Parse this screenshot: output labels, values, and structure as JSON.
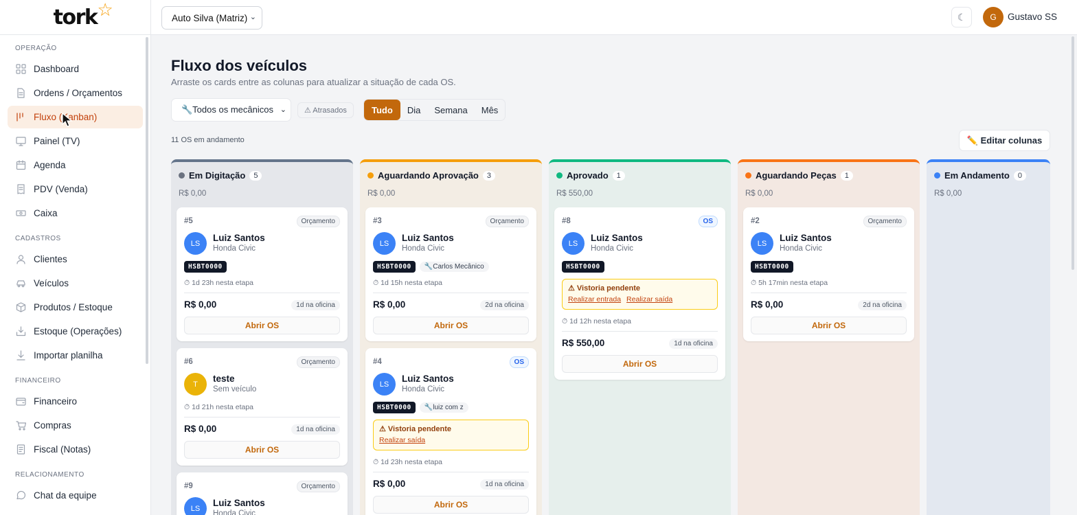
{
  "app": {
    "logo": "tork"
  },
  "topbar": {
    "branch": "Auto Silva (Matriz)",
    "user_initial": "G",
    "user_name": "Gustavo SS"
  },
  "sidebar": {
    "sections": [
      {
        "title": "OPERAÇÃO",
        "items": [
          {
            "label": "Dashboard",
            "icon": "dashboard-icon"
          },
          {
            "label": "Ordens / Orçamentos",
            "icon": "document-icon"
          },
          {
            "label": "Fluxo (Kanban)",
            "icon": "kanban-icon",
            "active": true
          },
          {
            "label": "Painel (TV)",
            "icon": "monitor-icon"
          },
          {
            "label": "Agenda",
            "icon": "calendar-icon"
          },
          {
            "label": "PDV (Venda)",
            "icon": "receipt-icon"
          },
          {
            "label": "Caixa",
            "icon": "cash-icon"
          }
        ]
      },
      {
        "title": "CADASTROS",
        "items": [
          {
            "label": "Clientes",
            "icon": "user-icon"
          },
          {
            "label": "Veículos",
            "icon": "car-icon"
          },
          {
            "label": "Produtos / Estoque",
            "icon": "box-icon"
          },
          {
            "label": "Estoque (Operações)",
            "icon": "inbox-icon"
          },
          {
            "label": "Importar planilha",
            "icon": "download-icon"
          }
        ]
      },
      {
        "title": "FINANCEIRO",
        "items": [
          {
            "label": "Financeiro",
            "icon": "wallet-icon"
          },
          {
            "label": "Compras",
            "icon": "cart-icon"
          },
          {
            "label": "Fiscal (Notas)",
            "icon": "invoice-icon"
          }
        ]
      },
      {
        "title": "RELACIONAMENTO",
        "items": [
          {
            "label": "Chat da equipe",
            "icon": "chat-icon"
          }
        ]
      }
    ]
  },
  "main": {
    "title": "Fluxo dos veículos",
    "subtitle": "Arraste os cards entre as colunas para atualizar a situação de cada OS.",
    "mechanic_filter": "🔧Todos os mecânicos",
    "late_label": "⚠ Atrasados",
    "periods": [
      "Tudo",
      "Dia",
      "Semana",
      "Mês"
    ],
    "active_period": "Tudo",
    "os_count": "11 OS em andamento",
    "edit_columns": "✏️ Editar colunas"
  },
  "columns": [
    {
      "title": "Em Digitação",
      "count": "5",
      "total": "R$ 0,00",
      "color": "#6b7280",
      "bg": "#e5e7eb",
      "border": "#64748b",
      "cards": [
        {
          "num": "#5",
          "badge": "Orçamento",
          "initials": "LS",
          "name": "Luiz Santos",
          "vehicle": "Honda Civic",
          "plate": "HSBT0000",
          "time": "⏱ 1d 23h nesta etapa",
          "price": "R$ 0,00",
          "shop": "1d na oficina",
          "open": "Abrir OS"
        },
        {
          "num": "#6",
          "badge": "Orçamento",
          "initials": "T",
          "name": "teste",
          "vehicle": "Sem veículo",
          "time": "⏱ 1d 21h nesta etapa",
          "price": "R$ 0,00",
          "shop": "1d na oficina",
          "open": "Abrir OS"
        },
        {
          "num": "#9",
          "badge": "Orçamento",
          "initials": "LS",
          "name": "Luiz Santos",
          "vehicle": "Honda Civic"
        }
      ]
    },
    {
      "title": "Aguardando Aprovação",
      "count": "3",
      "total": "R$ 0,00",
      "color": "#f59e0b",
      "bg": "#f3ede4",
      "border": "#f59e0b",
      "cards": [
        {
          "num": "#3",
          "badge": "Orçamento",
          "initials": "LS",
          "name": "Luiz Santos",
          "vehicle": "Honda Civic",
          "plate": "HSBT0000",
          "mechanic": "🔧Carlos Mecânico",
          "time": "⏱ 1d 15h nesta etapa",
          "price": "R$ 0,00",
          "shop": "2d na oficina",
          "open": "Abrir OS"
        },
        {
          "num": "#4",
          "badge": "OS",
          "initials": "LS",
          "name": "Luiz Santos",
          "vehicle": "Honda Civic",
          "plate": "HSBT0000",
          "mechanic": "🔧luiz com z",
          "warning": "⚠ Vistoria pendente",
          "warning_links": [
            "Realizar saída"
          ],
          "time": "⏱ 1d 23h nesta etapa",
          "price": "R$ 0,00",
          "shop": "1d na oficina",
          "open": "Abrir OS"
        }
      ]
    },
    {
      "title": "Aprovado",
      "count": "1",
      "total": "R$ 550,00",
      "color": "#10b981",
      "bg": "#e6efec",
      "border": "#10b981",
      "cards": [
        {
          "num": "#8",
          "badge": "OS",
          "initials": "LS",
          "name": "Luiz Santos",
          "vehicle": "Honda Civic",
          "plate": "HSBT0000",
          "warning": "⚠ Vistoria pendente",
          "warning_links": [
            "Realizar entrada",
            "Realizar saída"
          ],
          "time": "⏱ 1d 12h nesta etapa",
          "price": "R$ 550,00",
          "shop": "1d na oficina",
          "open": "Abrir OS"
        }
      ]
    },
    {
      "title": "Aguardando Peças",
      "count": "1",
      "total": "R$ 0,00",
      "color": "#f97316",
      "bg": "#f3e8e2",
      "border": "#f97316",
      "cards": [
        {
          "num": "#2",
          "badge": "Orçamento",
          "initials": "LS",
          "name": "Luiz Santos",
          "vehicle": "Honda Civic",
          "plate": "HSBT0000",
          "time": "⏱ 5h 17min nesta etapa",
          "price": "R$ 0,00",
          "shop": "2d na oficina",
          "open": "Abrir OS"
        }
      ]
    },
    {
      "title": "Em Andamento",
      "count": "0",
      "total": "R$ 0,00",
      "color": "#3b82f6",
      "bg": "#e3e8f0",
      "border": "#3b82f6",
      "cards": []
    }
  ]
}
